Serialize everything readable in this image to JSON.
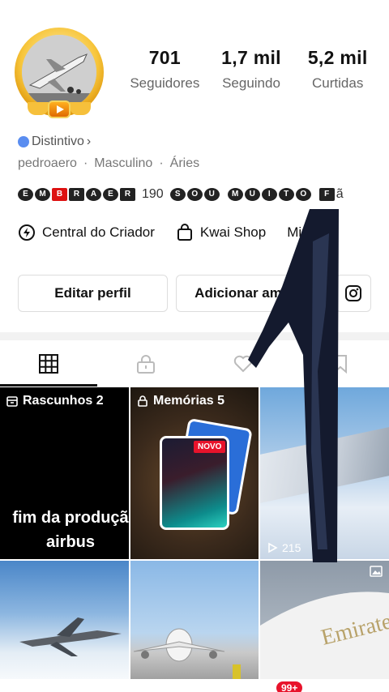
{
  "profile": {
    "stats": [
      {
        "value": "701",
        "label": "Seguidores"
      },
      {
        "value": "1,7 mil",
        "label": "Seguindo"
      },
      {
        "value": "5,2 mil",
        "label": "Curtidas"
      }
    ],
    "badge_label": "Distintivo",
    "badge_chevron": "›",
    "username": "pedroaero",
    "gender": "Masculino",
    "sign": "Áries",
    "separator": "·",
    "bio": {
      "symbols_1": [
        "E",
        "M",
        "B",
        "R",
        "A",
        "E",
        "R"
      ],
      "number": "190",
      "symbols_2": [
        "S",
        "O",
        "U"
      ],
      "symbols_3": [
        "M",
        "U",
        "I",
        "T",
        "O"
      ],
      "symbols_4": [
        "F"
      ],
      "tail": "ã"
    }
  },
  "quick_links": [
    {
      "label": "Central do Criador",
      "icon": "creator-center-icon"
    },
    {
      "label": "Kwai Shop",
      "icon": "shopping-bag-icon"
    },
    {
      "label": "Minha ",
      "icon": "none"
    }
  ],
  "buttons": {
    "edit_profile": "Editar perfil",
    "add_friends": "Adicionar amigos"
  },
  "tabs": [
    {
      "name": "grid-icon",
      "active": true
    },
    {
      "name": "lock-icon",
      "active": false
    },
    {
      "name": "heart-icon",
      "active": false
    },
    {
      "name": "bookmark-icon",
      "active": false
    }
  ],
  "grid": {
    "drafts": {
      "title": "Rascunhos 2",
      "text_line1": "fim da produçã",
      "text_line2": "airbus"
    },
    "memories": {
      "title": "Memórias 5",
      "new_badge": "NOVO"
    },
    "video1": {
      "views": "215"
    }
  },
  "nav": {
    "notification_count": "99+"
  },
  "colors": {
    "accent_red": "#e8132b",
    "badge_blue": "#5a8df0",
    "gold": "#f7c53a"
  }
}
